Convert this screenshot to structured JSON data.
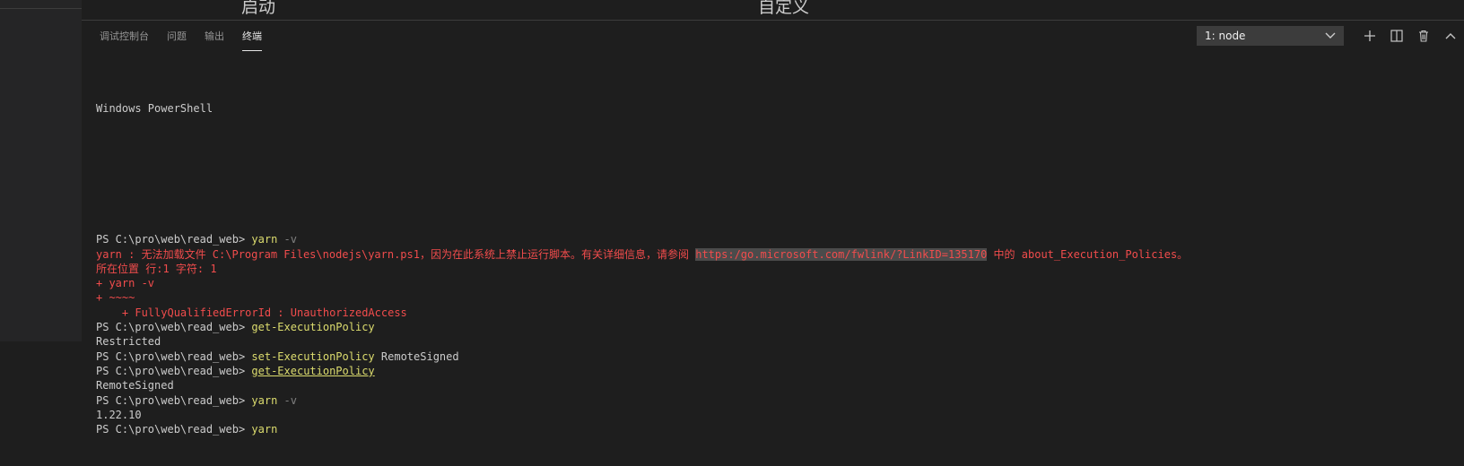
{
  "editor_strip": {
    "left_fragment": "启动",
    "right_fragment": "自定义"
  },
  "tabs": [
    {
      "label": "调试控制台",
      "active": false
    },
    {
      "label": "问题",
      "active": false
    },
    {
      "label": "输出",
      "active": false
    },
    {
      "label": "终端",
      "active": true
    }
  ],
  "terminal_select": {
    "value": "1: node"
  },
  "icons": {
    "add": "plus-icon",
    "split": "split-icon",
    "trash": "trash-icon",
    "collapse": "chevron-up-icon"
  },
  "terminal": {
    "header": "Windows PowerShell",
    "lines": [
      {
        "prompt": "PS C:\\pro\\web\\read_web> ",
        "cmd": "yarn",
        "arg": " -v"
      },
      {
        "err_pre": "yarn : 无法加载文件 C:\\Program Files\\nodejs\\yarn.ps1，因为在此系统上禁止运行脚本。有关详细信息，请参阅 ",
        "link": "https:/go.microsoft.com/fwlink/?LinkID=135170",
        "err_post": " 中的 about_Execution_Policies。"
      },
      {
        "err": "所在位置 行:1 字符: 1"
      },
      {
        "err": "+ yarn -v"
      },
      {
        "err": "+ ~~~~"
      },
      {
        "err": "    + FullyQualifiedErrorId : UnauthorizedAccess"
      },
      {
        "prompt": "PS C:\\pro\\web\\read_web> ",
        "cmd": "get-ExecutionPolicy",
        "arg": ""
      },
      {
        "out": "Restricted"
      },
      {
        "prompt": "PS C:\\pro\\web\\read_web> ",
        "cmd": "set-ExecutionPolicy",
        "arg": " RemoteSigned"
      },
      {
        "prompt": "PS C:\\pro\\web\\read_web> ",
        "cmd": "get-ExecutionPolicy",
        "arg": ""
      },
      {
        "out": "RemoteSigned"
      },
      {
        "prompt": "PS C:\\pro\\web\\read_web> ",
        "cmd": "yarn",
        "arg": " -v"
      },
      {
        "out": "1.22.10"
      },
      {
        "prompt": "PS C:\\pro\\web\\read_web> ",
        "cmd": "yarn",
        "arg": ""
      }
    ]
  },
  "colors": {
    "background": "#1e1e1e",
    "command": "#dcdc6e",
    "error": "#f14c4c",
    "text": "#cccccc"
  }
}
